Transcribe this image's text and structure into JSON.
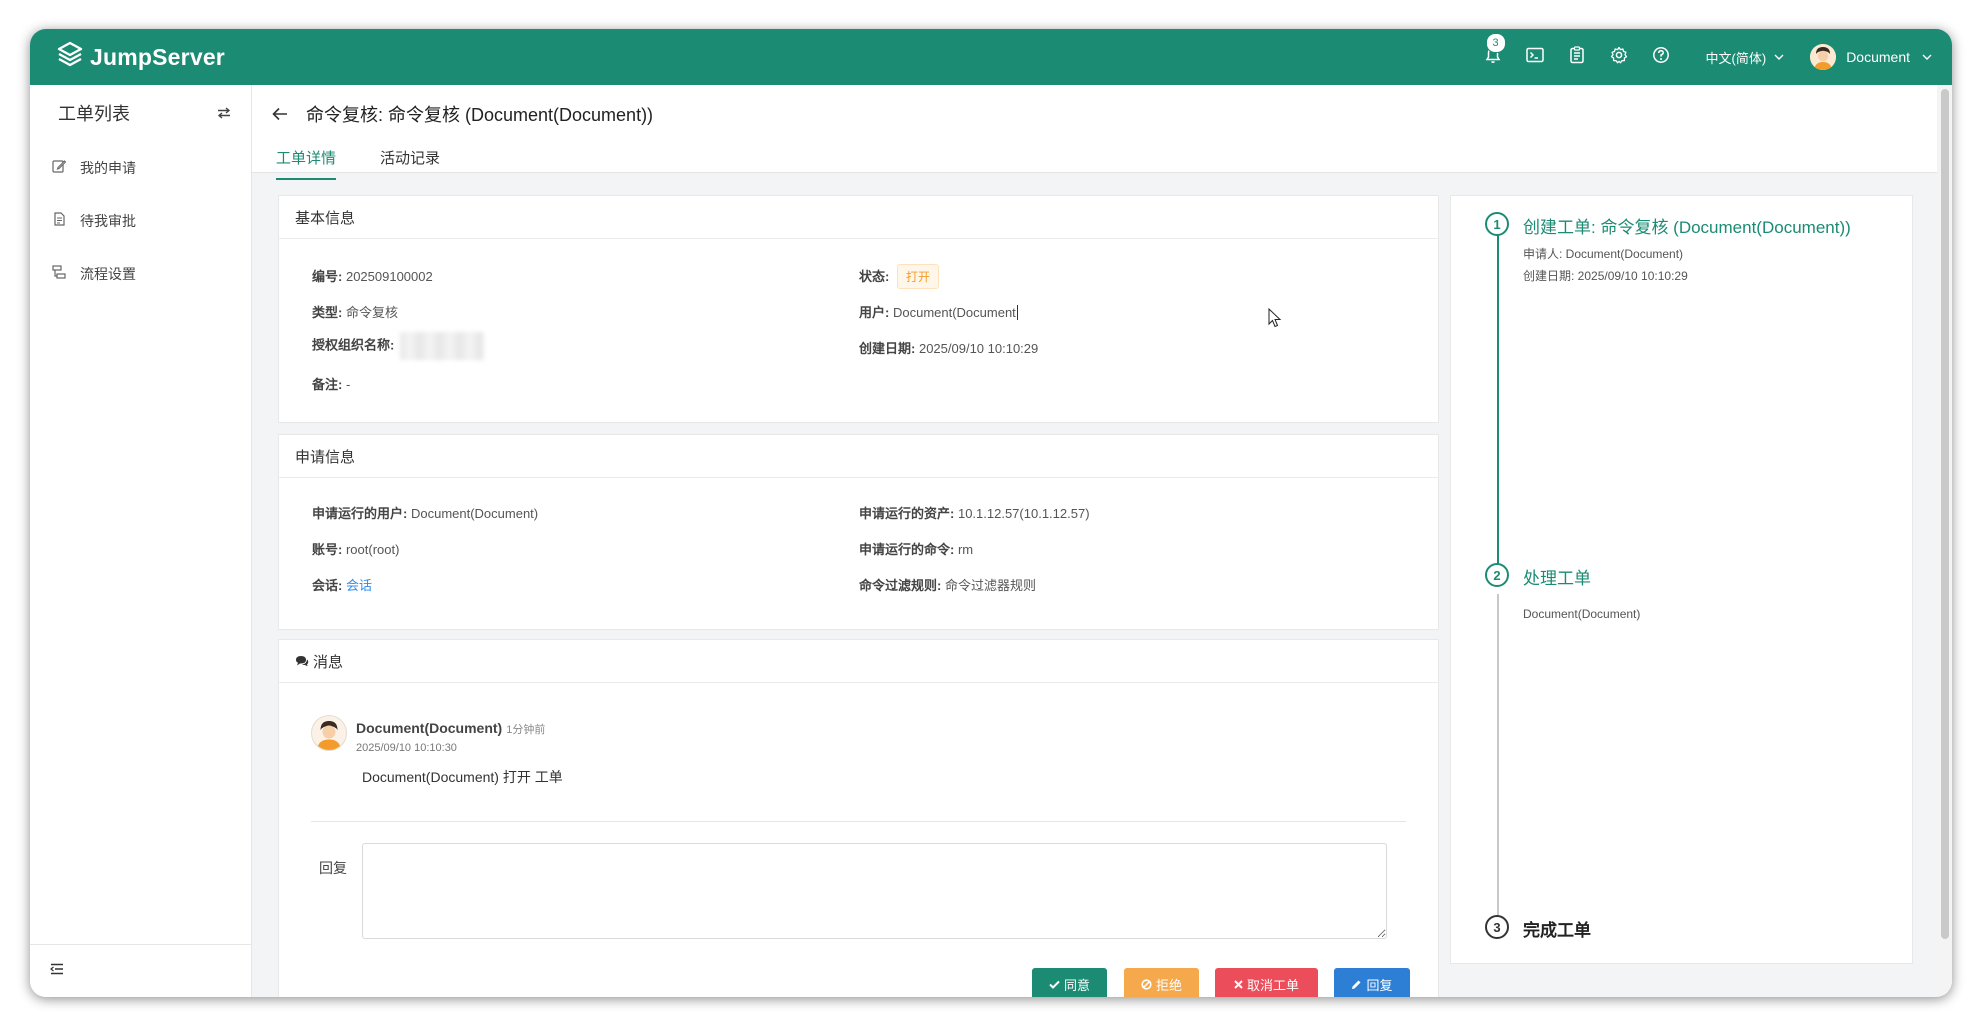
{
  "colors": {
    "brand": "#1b8b73",
    "approve": "#1b8b73",
    "reject": "#f5a94c",
    "cancel": "#eb4d5b",
    "reply": "#2d7fd6"
  },
  "header": {
    "app_name": "JumpServer",
    "notification_count": "3",
    "language": "中文(简体)",
    "user_name": "Document"
  },
  "sidebar": {
    "title": "工单列表",
    "items": [
      {
        "label": "我的申请",
        "icon": "edit-icon"
      },
      {
        "label": "待我审批",
        "icon": "document-icon"
      },
      {
        "label": "流程设置",
        "icon": "flow-icon"
      }
    ]
  },
  "page": {
    "title": "命令复核: 命令复核 (Document(Document))",
    "tabs": [
      "工单详情",
      "活动记录"
    ]
  },
  "basic_info": {
    "title": "基本信息",
    "fields": [
      {
        "label": "编号:",
        "value": "202509100002"
      },
      {
        "label": "类型:",
        "value": "命令复核"
      },
      {
        "label": "授权组织名称:",
        "value": ""
      },
      {
        "label": "备注:",
        "value": "-"
      },
      {
        "label": "状态:",
        "value": "打开"
      },
      {
        "label": "用户:",
        "value": "Document(Document"
      },
      {
        "label": "创建日期:",
        "value": "2025/09/10 10:10:29"
      }
    ]
  },
  "apply_info": {
    "title": "申请信息",
    "fields": [
      {
        "label": "申请运行的用户:",
        "value": "Document(Document)"
      },
      {
        "label": "账号:",
        "value": "root(root)"
      },
      {
        "label": "会话:",
        "value": "会话"
      },
      {
        "label": "申请运行的资产:",
        "value": "10.1.12.57(10.1.12.57)"
      },
      {
        "label": "申请运行的命令:",
        "value": "rm"
      },
      {
        "label": "命令过滤规则:",
        "value": "命令过滤器规则"
      }
    ]
  },
  "messages": {
    "title": "消息",
    "items": [
      {
        "author": "Document(Document)",
        "ago": "1分钟前",
        "date": "2025/09/10 10:10:30",
        "body": "Document(Document) 打开 工单"
      }
    ],
    "reply_label": "回复",
    "buttons": {
      "approve": "同意",
      "reject": "拒绝",
      "cancel": "取消工单",
      "reply": "回复"
    }
  },
  "timeline": {
    "steps": [
      {
        "num": "1",
        "title": "创建工单: 命令复核 (Document(Document))",
        "lines": [
          "申请人: Document(Document)",
          "创建日期: 2025/09/10 10:10:29"
        ]
      },
      {
        "num": "2",
        "title": "处理工单",
        "lines": [
          "Document(Document)"
        ]
      },
      {
        "num": "3",
        "title": "完成工单",
        "lines": []
      }
    ]
  }
}
